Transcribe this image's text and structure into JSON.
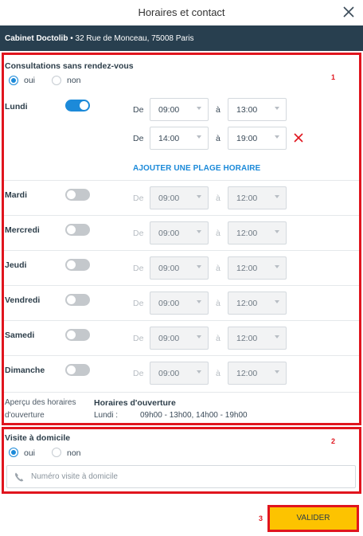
{
  "header": {
    "title": "Horaires et contact"
  },
  "bar": {
    "name": "Cabinet Doctolib",
    "address": " • 32 Rue de Monceau, 75008 Paris"
  },
  "annotations": [
    "1",
    "2",
    "3"
  ],
  "consultations": {
    "title": "Consultations sans rendez-vous",
    "oui": "oui",
    "non": "non",
    "selected": "oui"
  },
  "labels": {
    "de": "De",
    "a": "à",
    "add_slot": "AJOUTER UNE PLAGE HORAIRE"
  },
  "days": {
    "lundi": {
      "name": "Lundi",
      "enabled": true,
      "slots": [
        {
          "from": "09:00",
          "to": "13:00"
        },
        {
          "from": "14:00",
          "to": "19:00"
        }
      ]
    },
    "mardi": {
      "name": "Mardi",
      "enabled": false,
      "from": "09:00",
      "to": "12:00"
    },
    "mercredi": {
      "name": "Mercredi",
      "enabled": false,
      "from": "09:00",
      "to": "12:00"
    },
    "jeudi": {
      "name": "Jeudi",
      "enabled": false,
      "from": "09:00",
      "to": "12:00"
    },
    "vendredi": {
      "name": "Vendredi",
      "enabled": false,
      "from": "09:00",
      "to": "12:00"
    },
    "samedi": {
      "name": "Samedi",
      "enabled": false,
      "from": "09:00",
      "to": "12:00"
    },
    "dimanche": {
      "name": "Dimanche",
      "enabled": false,
      "from": "09:00",
      "to": "12:00"
    }
  },
  "summary": {
    "label": "Aperçu des horaires d'ouverture",
    "title": "Horaires d'ouverture",
    "day": "Lundi :",
    "hours": "09h00 - 13h00, 14h00 - 19h00"
  },
  "visite": {
    "title": "Visite à domicile",
    "oui": "oui",
    "non": "non",
    "selected": "oui",
    "placeholder": "Numéro visite à domicile"
  },
  "footer": {
    "valider": "VALIDER"
  },
  "colors": {
    "accent": "#1c8ad9",
    "header_bar": "#283f4f",
    "annotation_red": "#e0151e",
    "valider_yellow": "#fdc300"
  },
  "icons": {
    "close": "close-icon",
    "remove": "remove-slot-icon",
    "phone": "phone-icon"
  }
}
